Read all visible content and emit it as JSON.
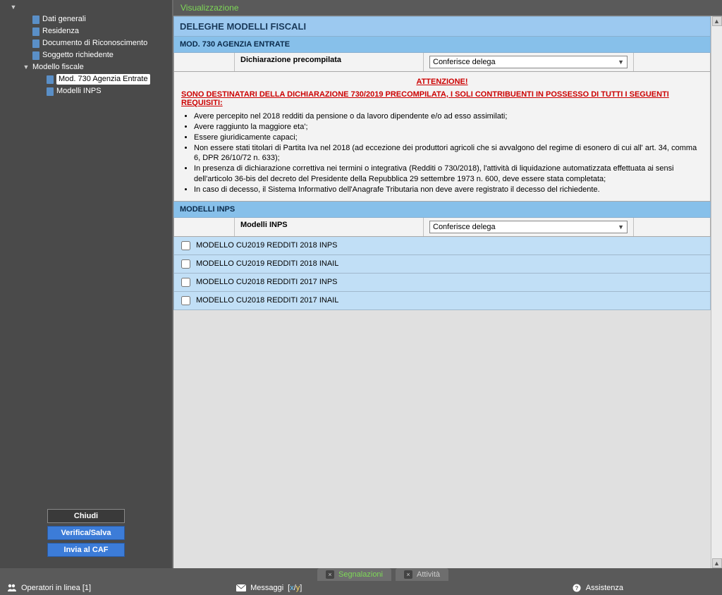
{
  "mode_label": "Visualizzazione",
  "sidebar": {
    "items": [
      {
        "label": "Dati generali"
      },
      {
        "label": "Residenza"
      },
      {
        "label": "Documento di Riconoscimento"
      },
      {
        "label": "Soggetto richiedente"
      },
      {
        "label": "Modello fiscale"
      },
      {
        "label": "Mod. 730 Agenzia Entrate"
      },
      {
        "label": "Modelli INPS"
      }
    ],
    "buttons": {
      "close": "Chiudi",
      "verify": "Verifica/Salva",
      "send": "Invia al CAF"
    }
  },
  "panel": {
    "title": "DELEGHE MODELLI FISCALI",
    "section730": {
      "header": "MOD. 730 AGENZIA ENTRATE",
      "row_label": "Dichiarazione precompilata",
      "select_value": "Conferisce delega"
    },
    "warning": {
      "title": "ATTENZIONE!",
      "subtitle": "SONO DESTINATARI DELLA DICHIARAZIONE 730/2019 PRECOMPILATA, I SOLI CONTRIBUENTI IN POSSESSO DI TUTTI I SEGUENTI REQUISITI:",
      "bullets": [
        "Avere percepito nel 2018 redditi da pensione o da lavoro dipendente e/o ad esso assimilati;",
        "Avere raggiunto la maggiore eta';",
        "Essere giuridicamente capaci;",
        "Non essere stati titolari di Partita Iva nel 2018 (ad eccezione dei produttori agricoli che si avvalgono del regime di esonero di cui all' art. 34, comma 6, DPR 26/10/72 n. 633);",
        "In presenza di dichiarazione correttiva nei termini o integrativa (Redditi o 730/2018), l'attività di liquidazione automatizzata effettuata ai sensi dell'articolo 36-bis del decreto del Presidente della Repubblica 29 settembre 1973 n. 600, deve essere stata completata;",
        "In caso di decesso, il Sistema Informativo dell'Anagrafe Tributaria non deve avere registrato il decesso del richiedente."
      ]
    },
    "sectionINPS": {
      "header": "MODELLI INPS",
      "row_label": "Modelli INPS",
      "select_value": "Conferisce delega",
      "models": [
        "MODELLO CU2019 REDDITI 2018 INPS",
        "MODELLO CU2019 REDDITI 2018 INAIL",
        "MODELLO CU2018 REDDITI 2017 INPS",
        "MODELLO CU2018 REDDITI 2017 INAIL"
      ]
    }
  },
  "tabs": {
    "segnalazioni": "Segnalazioni",
    "attivita": "Attività"
  },
  "status": {
    "operators": "Operatori in linea [1]",
    "messages_label": "Messaggi",
    "messages_a": "x",
    "messages_sep": "/",
    "messages_b": "y",
    "assistenza": "Assistenza"
  }
}
